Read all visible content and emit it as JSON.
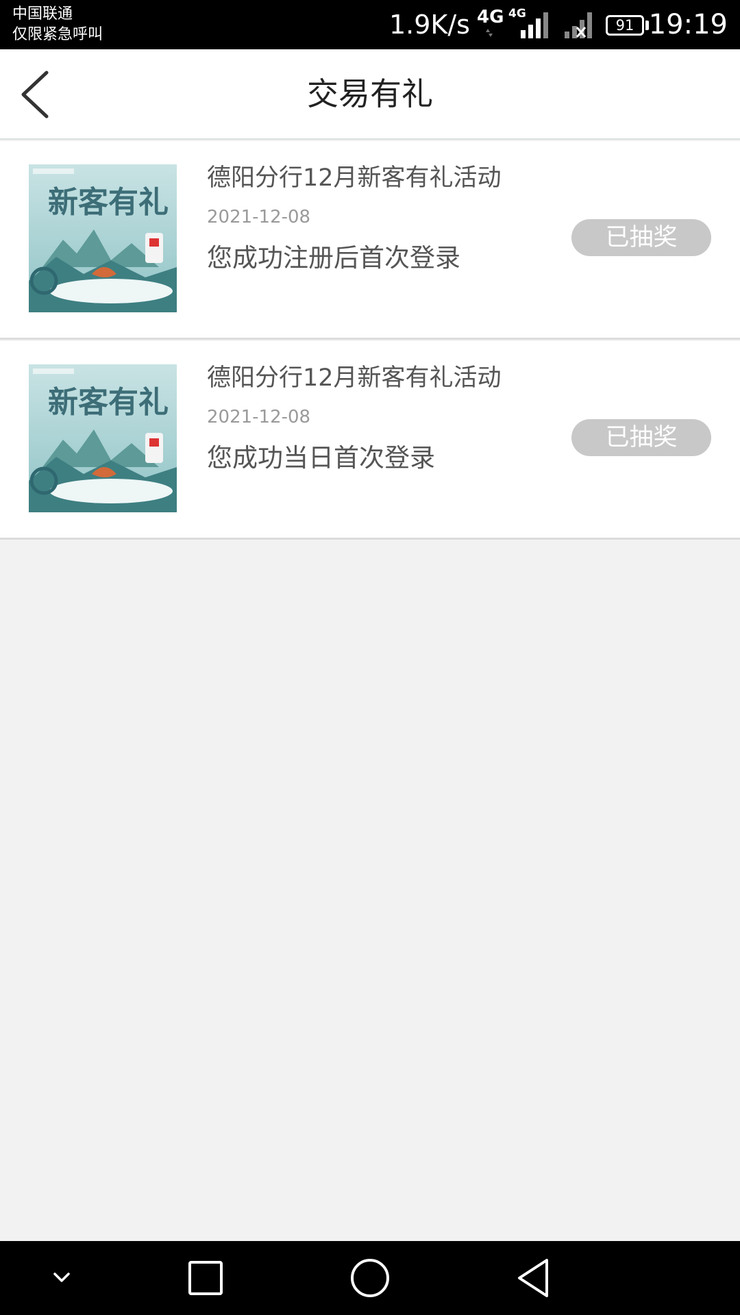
{
  "status_bar": {
    "carrier_line1": "中国联通",
    "carrier_line2": "仅限紧急呼叫",
    "net_speed": "1.9K/s",
    "network_type_1": "4G",
    "network_type_2": "4G",
    "battery_level": "91",
    "time": "19:19",
    "icons": [
      "data-arrows-icon",
      "signal-bars-icon",
      "signal-no-service-icon",
      "battery-icon"
    ]
  },
  "header": {
    "title": "交易有礼",
    "back_icon": "chevron-left-icon"
  },
  "activities": [
    {
      "title": "德阳分行12月新客有礼活动",
      "date": "2021-12-08",
      "description": "您成功注册后首次登录",
      "status": "已抽奖",
      "thumbnail_text": "新客有礼"
    },
    {
      "title": "德阳分行12月新客有礼活动",
      "date": "2021-12-08",
      "description": "您成功当日首次登录",
      "status": "已抽奖",
      "thumbnail_text": "新客有礼"
    }
  ],
  "nav_bar": {
    "buttons": [
      "collapse-icon",
      "recent-apps-icon",
      "home-icon",
      "back-icon"
    ]
  },
  "colors": {
    "status_bar_bg": "#000000",
    "header_bg": "#ffffff",
    "page_bg": "#f2f2f2",
    "badge_bg": "#c8c8c8",
    "badge_text": "#ffffff",
    "title_text": "#222222",
    "item_text": "#555555",
    "date_text": "#9a9a9a"
  }
}
